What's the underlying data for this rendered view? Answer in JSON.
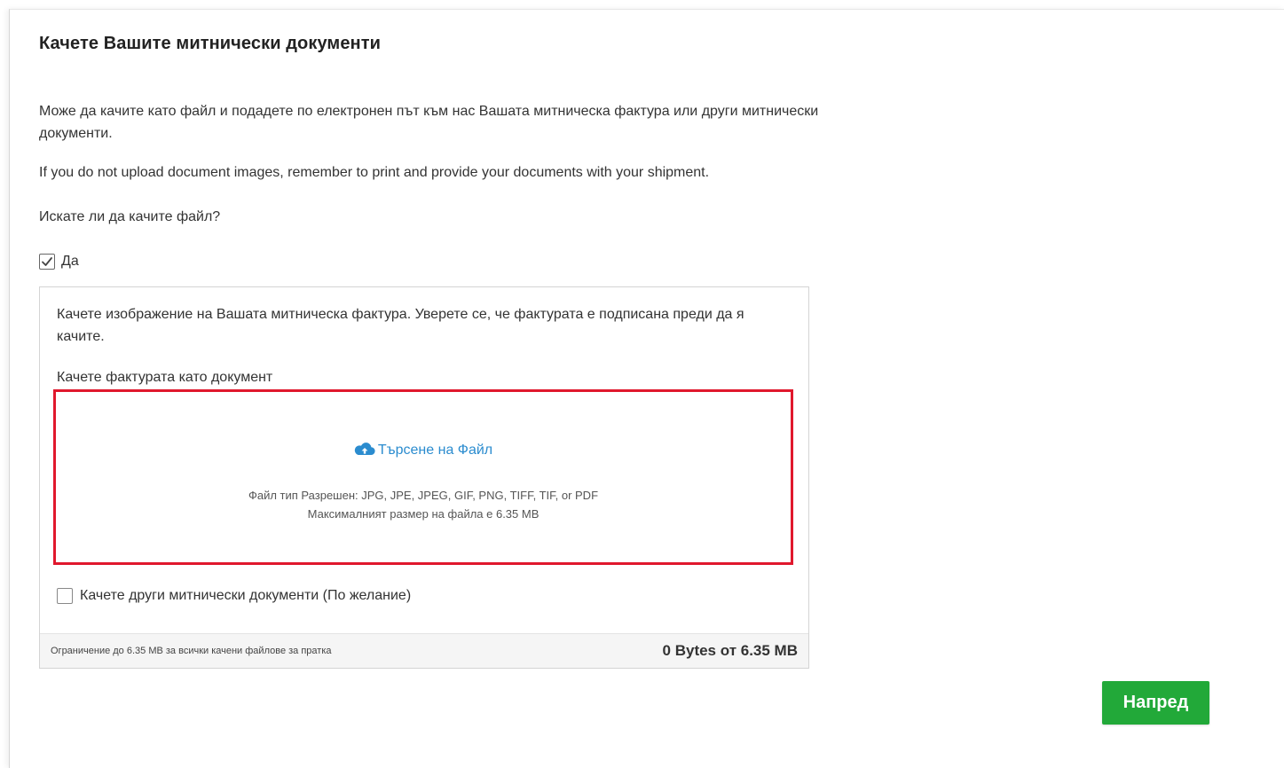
{
  "page": {
    "title": "Качете Вашите митнически документи",
    "intro": "Може да качите като файл и подадете по електронен път към нас Вашата митническа фактура или други митнически документи.",
    "note": "If you do not upload document images, remember to print and provide your documents with your shipment.",
    "question": "Искате ли да качите файл?",
    "yes_checkbox": {
      "label": "Да",
      "checked": true
    }
  },
  "upload_panel": {
    "description": "Качете изображение на Вашата митническа фактура. Уверете се, че фактурата е подписана преди да я качите.",
    "invoice_label": "Качете фактурата като документ",
    "dropzone": {
      "browse_label": "Търсене на Файл",
      "browse_icon": "cloud-upload-icon",
      "allowed_types": "Файл тип Разрешен: JPG, JPE, JPEG, GIF, PNG, TIFF, TIF, or PDF",
      "max_size": "Максималният размер на файла е 6.35 MB",
      "highlight_color": "#e0182d",
      "link_color": "#2b8ccf"
    },
    "other_docs_checkbox": {
      "label": "Качете други митнически документи (По желание)",
      "checked": false
    },
    "footer": {
      "limit_note": "Ограничение до 6.35 MB за всички качени файлове за пратка",
      "usage": "0 Bytes от 6.35 MB"
    }
  },
  "actions": {
    "next_label": "Напред",
    "next_color": "#22a939"
  }
}
